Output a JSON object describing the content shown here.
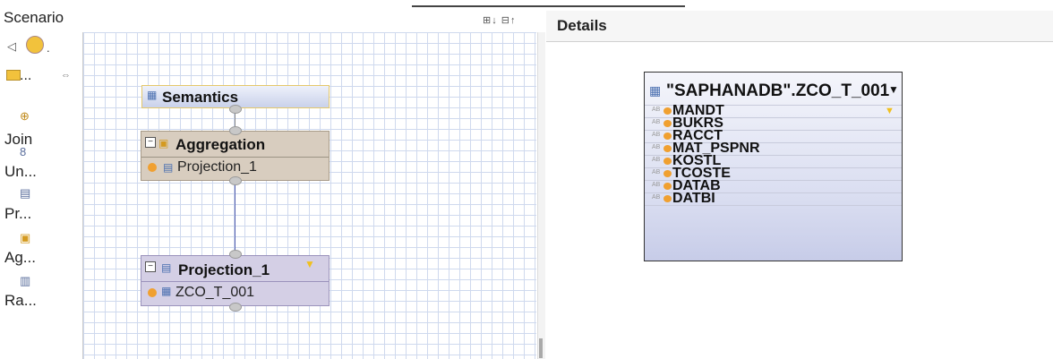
{
  "scenario": {
    "title": "Scenario",
    "header_icons": "⊞↓ ⊟↑"
  },
  "palette": {
    "items": [
      {
        "label": "Join",
        "icon": "join-icon"
      },
      {
        "label": "Un...",
        "icon": "union-icon"
      },
      {
        "label": "Pr...",
        "icon": "projection-icon"
      },
      {
        "label": "Ag...",
        "icon": "aggregation-icon"
      },
      {
        "label": "Ra...",
        "icon": "rank-icon"
      }
    ],
    "folder_label": "..."
  },
  "nodes": {
    "semantics": {
      "title": "Semantics"
    },
    "aggregation": {
      "title": "Aggregation",
      "input": "Projection_1"
    },
    "projection": {
      "title": "Projection_1",
      "input": "ZCO_T_001"
    }
  },
  "details": {
    "title": "Details",
    "table": {
      "name": "\"SAPHANADB\".ZCO_T_001",
      "columns": [
        "MANDT",
        "BUKRS",
        "RACCT",
        "MAT_PSPNR",
        "KOSTL",
        "TCOSTE",
        "DATAB",
        "DATBI"
      ]
    }
  },
  "colors": {
    "grid": "#cfd9ee",
    "aggregation_bg": "#d8cdbf",
    "projection_bg": "#d4cfe5",
    "key_dot": "#f0a030",
    "filter": "#f0c020"
  }
}
